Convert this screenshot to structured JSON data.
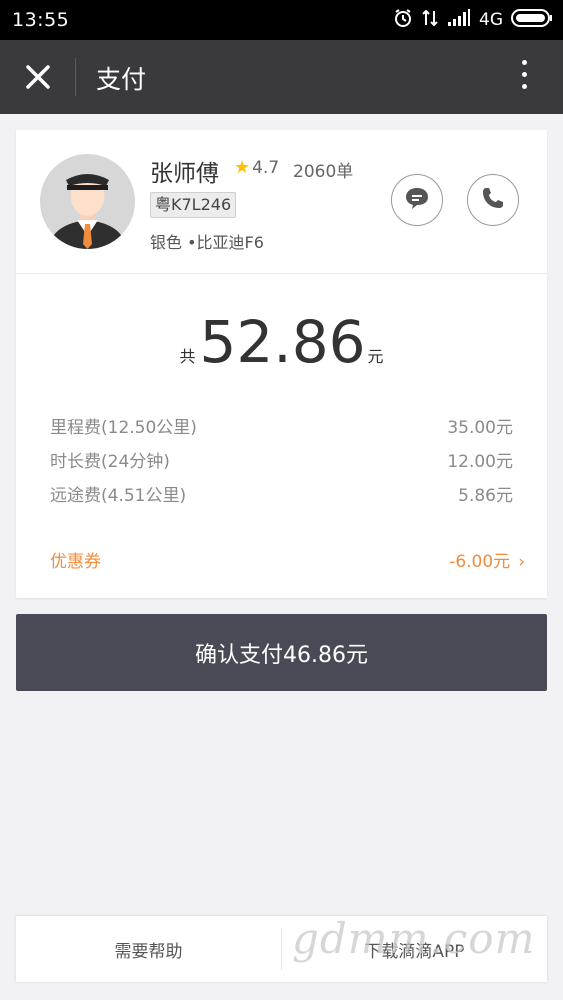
{
  "status_bar": {
    "time": "13:55",
    "network": "4G"
  },
  "header": {
    "title": "支付"
  },
  "driver": {
    "name": "张师傅",
    "rating": "4.7",
    "orders": "2060单",
    "plate": "粤K7L246",
    "car": "银色 •比亚迪F6"
  },
  "total": {
    "prefix": "共",
    "amount": "52.86",
    "unit": "元"
  },
  "fees": [
    {
      "label": "里程费(12.50公里)",
      "value": "35.00元"
    },
    {
      "label": "时长费(24分钟)",
      "value": "12.00元"
    },
    {
      "label": "远途费(4.51公里)",
      "value": "5.86元"
    }
  ],
  "coupon": {
    "label": "优惠券",
    "value": "-6.00元"
  },
  "confirm_button": "确认支付46.86元",
  "bottom_bar": {
    "help": "需要帮助",
    "download": "下载滴滴APP"
  },
  "watermark": "gdmm.com",
  "colors": {
    "header_bg": "#3a3a3e",
    "confirm_bg": "#4a4a56",
    "coupon_orange": "#f08c3c",
    "star_yellow": "#ffc107"
  },
  "icons": {
    "close": "close-icon",
    "more": "more-vertical-icon",
    "message": "chat-bubble-icon",
    "phone": "phone-icon",
    "star": "star-icon",
    "chevron": "chevron-right-icon"
  }
}
